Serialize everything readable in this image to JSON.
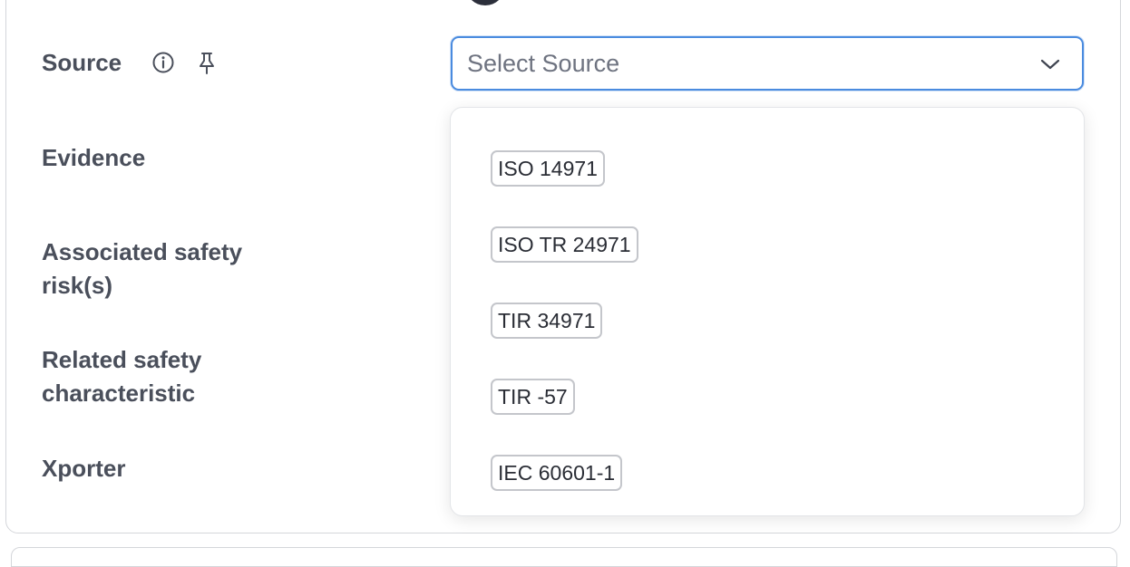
{
  "form": {
    "fields": {
      "source": "Source",
      "evidence": "Evidence",
      "associated_line1": "Associated safety",
      "associated_line2": "risk(s)",
      "related_line1": "Related safety",
      "related_line2": "characteristic",
      "xporter": "Xporter"
    },
    "source_select": {
      "placeholder": "Select Source",
      "options": [
        "ISO 14971",
        "ISO TR 24971",
        "TIR 34971",
        "TIR -57",
        "IEC 60601-1"
      ]
    }
  },
  "colors": {
    "focus_border": "#4a8bdf",
    "label_text": "#4a4f5b",
    "tag_border": "#c4c6cb"
  },
  "icons": {
    "source_info": "info-icon",
    "source_pin": "pin-icon",
    "select_toggle": "chevron-down-icon"
  }
}
